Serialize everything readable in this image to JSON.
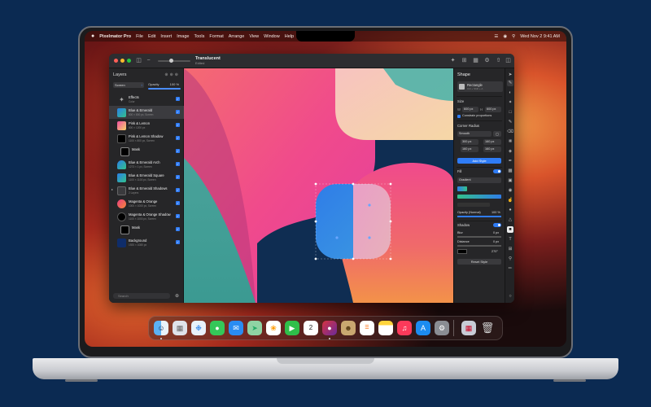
{
  "menubar": {
    "app": "Pixelmator Pro",
    "items": [
      "File",
      "Edit",
      "Insert",
      "Image",
      "Tools",
      "Format",
      "Arrange",
      "View",
      "Window",
      "Help"
    ],
    "clock": "Wed Nov 2  9:41 AM"
  },
  "document": {
    "title": "Translucent",
    "subtitle": "Edited"
  },
  "layers_panel": {
    "title": "Layers",
    "blend_mode": "Screen",
    "opacity_label": "Opacity",
    "opacity_value": "100 %",
    "search_placeholder": "Search",
    "items": [
      {
        "name": "Effects",
        "sub": "Color"
      },
      {
        "name": "Blue & Emerald",
        "sub": "800 × 800 px, Screen"
      },
      {
        "name": "Pink & Lemon",
        "sub": "800 × 1200 px"
      },
      {
        "name": "Pink & Lemon Shadow",
        "sub": "1100 × 800 px, Screen"
      },
      {
        "name": "Mask",
        "sub": ""
      },
      {
        "name": "Blue & Emerald Arch",
        "sub": "1273 × 1 px, Screen"
      },
      {
        "name": "Blue & Emerald Square",
        "sub": "1100 × 1100 px, Screen"
      },
      {
        "name": "Blue & Emerald Shadows",
        "sub": "2 Layers"
      },
      {
        "name": "Magenta & Orange",
        "sub": "1000 × 1000 px, Screen"
      },
      {
        "name": "Magenta & Orange Shadow",
        "sub": "1100 × 1000 px, Screen"
      },
      {
        "name": "Mask",
        "sub": ""
      },
      {
        "name": "Background",
        "sub": "1920 × 1080 px"
      }
    ]
  },
  "shape_panel": {
    "title": "Shape",
    "shape_type": "Rectangle",
    "shape_sub": "Ctrl + Shift + A",
    "size_label": "Size",
    "width_label": "W",
    "width": "600 px",
    "height_label": "H",
    "height": "600 px",
    "constrain": "Constrain proportions",
    "corner_label": "Corner Radius",
    "corner_type": "Smooth",
    "corner_tl": "300 px",
    "corner_tr": "160 px",
    "corner_bl": "160 px",
    "corner_br": "160 px",
    "add_style": "Add Style",
    "fill_label": "Fill",
    "fill_type": "Gradient",
    "opacity_label": "Opacity (Normal)",
    "opacity_value": "100 %",
    "shadow_label": "Shadow",
    "blur_label": "Blur",
    "blur_value": "0 px",
    "distance_label": "Distance",
    "distance_value": "0 px",
    "angle_value": "270°",
    "reset": "Reset Style"
  },
  "dock": {
    "apps": [
      "Finder",
      "Launchpad",
      "Safari",
      "Messages",
      "Mail",
      "Maps",
      "Photos",
      "FaceTime",
      "Calendar",
      "Pixelmator Pro",
      "Contacts",
      "Reminders",
      "Notes",
      "Music",
      "App Store",
      "System Settings",
      "Preview",
      "Trash"
    ],
    "calendar_day": "2"
  },
  "colors": {
    "accent": "#2f7cf6",
    "background": "#0b2a52"
  }
}
